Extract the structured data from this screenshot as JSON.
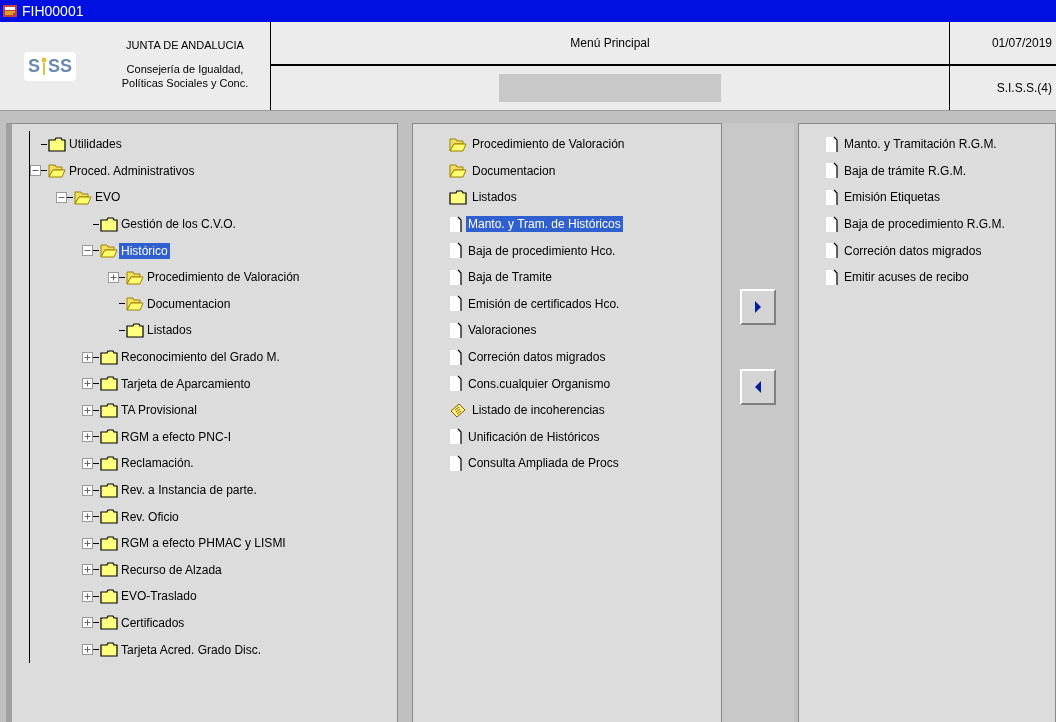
{
  "window": {
    "title": "FIH00001"
  },
  "header": {
    "logo": {
      "left": "S",
      "right": "SS"
    },
    "organization": "JUNTA DE ANDALUCIA",
    "department": "Consejería de Igualdad,",
    "department_line_2": "Políticas Sociales y Conc.",
    "title": "Menú Principal",
    "date": "01/07/2019",
    "system": "S.I.S.S.(4)"
  },
  "tree": [
    {
      "label": "Utilidades",
      "kind": "folder",
      "selected": false
    },
    {
      "label": "Proced. Administrativos",
      "kind": "open-folder",
      "expanded": true,
      "selected": false,
      "children": [
        {
          "label": "EVO",
          "kind": "open-folder",
          "expanded": true,
          "selected": false,
          "children": [
            {
              "label": "Gestión de los C.V.O.",
              "kind": "folder",
              "selected": false
            },
            {
              "label": "Histórico",
              "kind": "open-folder",
              "expanded": true,
              "selected": true,
              "children": [
                {
                  "label": "Procedimiento de Valoración",
                  "kind": "open-folder",
                  "expanded": false,
                  "selected": false
                },
                {
                  "label": "Documentacion",
                  "kind": "open-folder",
                  "selected": false
                },
                {
                  "label": "Listados",
                  "kind": "folder",
                  "selected": false
                }
              ]
            },
            {
              "label": "Reconocimiento del Grado M.",
              "kind": "folder",
              "expanded": false,
              "selected": false
            },
            {
              "label": "Tarjeta de Aparcamiento",
              "kind": "folder",
              "expanded": false,
              "selected": false
            },
            {
              "label": "TA Provisional",
              "kind": "folder",
              "expanded": false,
              "selected": false
            },
            {
              "label": "RGM a efecto PNC-I",
              "kind": "folder",
              "expanded": false,
              "selected": false
            },
            {
              "label": "Reclamación.",
              "kind": "folder",
              "expanded": false,
              "selected": false
            },
            {
              "label": "Rev. a Instancia de parte.",
              "kind": "folder",
              "expanded": false,
              "selected": false
            },
            {
              "label": "Rev. Oficio",
              "kind": "folder",
              "expanded": false,
              "selected": false
            },
            {
              "label": "RGM a efecto PHMAC y LISMI",
              "kind": "folder",
              "expanded": false,
              "selected": false
            },
            {
              "label": "Recurso de Alzada",
              "kind": "folder",
              "expanded": false,
              "selected": false
            },
            {
              "label": "EVO-Traslado",
              "kind": "folder",
              "expanded": false,
              "selected": false
            },
            {
              "label": "Certificados",
              "kind": "folder",
              "expanded": false,
              "selected": false
            },
            {
              "label": "Tarjeta Acred. Grado Disc.",
              "kind": "folder",
              "expanded": false,
              "selected": false
            }
          ]
        }
      ]
    }
  ],
  "contents": [
    {
      "label": "Procedimiento de Valoración",
      "kind": "open-folder",
      "selected": false
    },
    {
      "label": "Documentacion",
      "kind": "open-folder",
      "selected": false
    },
    {
      "label": "Listados",
      "kind": "folder",
      "selected": false
    },
    {
      "label": "Manto. y Tram. de Históricos",
      "kind": "document",
      "selected": true
    },
    {
      "label": "Baja de procedimiento Hco.",
      "kind": "document",
      "selected": false
    },
    {
      "label": "Baja de Tramite",
      "kind": "document",
      "selected": false
    },
    {
      "label": "Emisión de certificados Hco.",
      "kind": "document",
      "selected": false
    },
    {
      "label": "Valoraciones",
      "kind": "document",
      "selected": false
    },
    {
      "label": "Correción datos migrados",
      "kind": "document",
      "selected": false
    },
    {
      "label": "Cons.cualquier Organismo",
      "kind": "document",
      "selected": false
    },
    {
      "label": "Listado de incoherencias",
      "kind": "notes",
      "selected": false
    },
    {
      "label": "Unificación de Históricos",
      "kind": "document",
      "selected": false
    },
    {
      "label": "Consulta Ampliada de Procs",
      "kind": "document",
      "selected": false
    }
  ],
  "transfer_buttons": [
    {
      "kind": "add"
    },
    {
      "kind": "remove"
    }
  ],
  "favorites": [
    {
      "label": "Manto. y Tramitación R.G.M.",
      "kind": "document",
      "selected": false
    },
    {
      "label": "Baja de trámite R.G.M.",
      "kind": "document",
      "selected": false
    },
    {
      "label": "Emisión Etiquetas",
      "kind": "document",
      "selected": false
    },
    {
      "label": "Baja de procedimiento R.G.M.",
      "kind": "document",
      "selected": false
    },
    {
      "label": "Correción datos migrados",
      "kind": "document",
      "selected": false
    },
    {
      "label": "Emitir acuses de recibo",
      "kind": "document",
      "selected": false
    }
  ]
}
